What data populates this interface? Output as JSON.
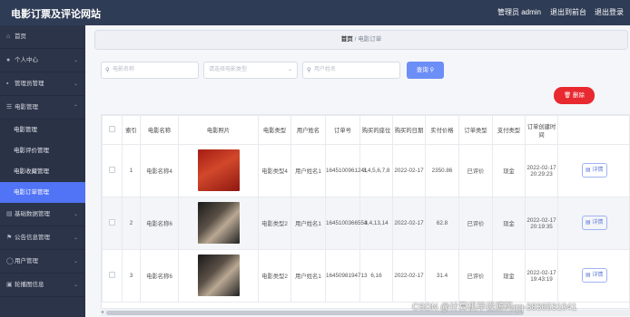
{
  "header": {
    "title": "电影订票及评论网站",
    "admin_label": "管理员 admin",
    "front_label": "退出到前台",
    "logout_label": "退出登录"
  },
  "sidebar": {
    "items": [
      {
        "label": "首页",
        "icon": "home-icon"
      },
      {
        "label": "个人中心",
        "icon": "user-icon"
      },
      {
        "label": "管理员管理",
        "icon": "admin-icon"
      },
      {
        "label": "电影管理",
        "icon": "film-icon"
      },
      {
        "label": "基础数据管理",
        "icon": "data-icon"
      },
      {
        "label": "公告信息管理",
        "icon": "flag-icon"
      },
      {
        "label": "用户管理",
        "icon": "user-circle-icon"
      },
      {
        "label": "轮播图信息",
        "icon": "image-icon"
      }
    ],
    "sub_items": [
      "电影管理",
      "电影评价管理",
      "电影收藏管理",
      "电影订单管理"
    ]
  },
  "breadcrumb": {
    "home": "首页",
    "separator": "/",
    "current": "电影订单"
  },
  "search": {
    "movie_name_placeholder": "电影名称",
    "movie_type_placeholder": "请选择电影类型",
    "user_name_placeholder": "用户姓名",
    "search_label": "查询"
  },
  "actions": {
    "delete_label": "删除"
  },
  "table": {
    "headers": [
      "索引",
      "电影名称",
      "电影照片",
      "电影类型",
      "用户姓名",
      "订单号",
      "购买的座位",
      "购买的日期",
      "实付价格",
      "订单类型",
      "支付类型",
      "订单创建时间",
      ""
    ],
    "rows": [
      {
        "index": "1",
        "movie_name": "电影名称4",
        "movie_type": "电影类型4",
        "user_name": "用户姓名1",
        "order_no": "1645100961241",
        "seats": "3,4,5,6,7,8",
        "date": "2022-02-17",
        "price": "2350.86",
        "order_type": "已评价",
        "pay_type": "现金",
        "created": "2022-02-17 20:29:23",
        "action": "详情"
      },
      {
        "index": "2",
        "movie_name": "电影名称6",
        "movie_type": "电影类型2",
        "user_name": "用户姓名1",
        "order_no": "1645100366554",
        "seats": "3,4,13,14",
        "date": "2022-02-17",
        "price": "62.8",
        "order_type": "已评价",
        "pay_type": "现金",
        "created": "2022-02-17 20:19:35",
        "action": "详情"
      },
      {
        "index": "3",
        "movie_name": "电影名称6",
        "movie_type": "电影类型2",
        "user_name": "用户姓名1",
        "order_no": "1645098194713",
        "seats": "6,16",
        "date": "2022-02-17",
        "price": "31.4",
        "order_type": "已评价",
        "pay_type": "现金",
        "created": "2022-02-17 19:43:19",
        "action": "详情"
      }
    ]
  },
  "watermark": "CSDN @计算机毕设源码qq-3836531041",
  "colors": {
    "topbar": "#2f3c55",
    "sidebar": "#2c3449",
    "active": "#5173f5",
    "delete": "#e8292f",
    "search": "#6c8ef7"
  }
}
